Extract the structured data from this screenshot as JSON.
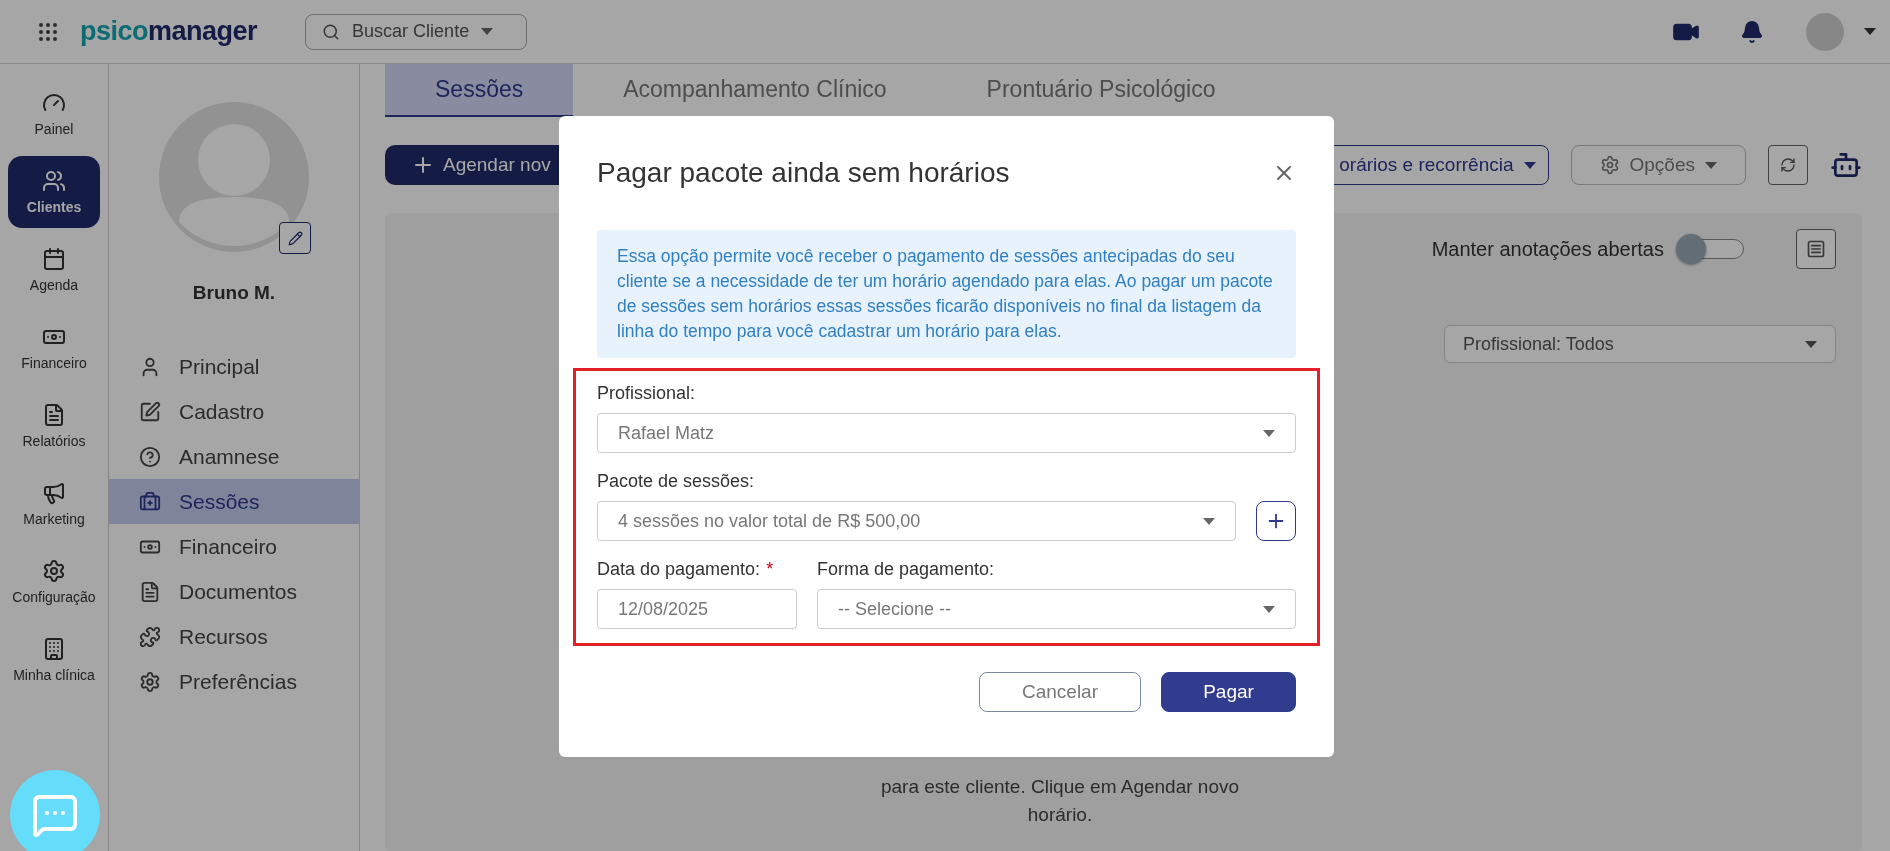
{
  "topbar": {
    "logo": [
      "psico",
      "manager"
    ],
    "search": {
      "label": "Buscar Cliente"
    }
  },
  "nav_rail": [
    {
      "label": "Painel",
      "selected": false
    },
    {
      "label": "Clientes",
      "selected": true
    },
    {
      "label": "Agenda",
      "selected": false
    },
    {
      "label": "Financeiro",
      "selected": false
    },
    {
      "label": "Relatórios",
      "selected": false
    },
    {
      "label": "Marketing",
      "selected": false
    },
    {
      "label": "Configuração",
      "selected": false
    },
    {
      "label": "Minha clínica",
      "selected": false
    }
  ],
  "client": {
    "name": "Bruno M."
  },
  "client_menu": [
    {
      "label": "Principal",
      "selected": false
    },
    {
      "label": "Cadastro",
      "selected": false
    },
    {
      "label": "Anamnese",
      "selected": false
    },
    {
      "label": "Sessões",
      "selected": true
    },
    {
      "label": "Financeiro",
      "selected": false
    },
    {
      "label": "Documentos",
      "selected": false
    },
    {
      "label": "Recursos",
      "selected": false
    },
    {
      "label": "Preferências",
      "selected": false
    }
  ],
  "tabs": [
    {
      "label": "Sessões",
      "selected": true
    },
    {
      "label": "Acompanhamento Clínico",
      "selected": false
    },
    {
      "label": "Prontuário Psicológico",
      "selected": false
    }
  ],
  "toolbar": {
    "new_button": "Agendar nov",
    "schedule_button": "orários e recorrência",
    "options_button": "Opções"
  },
  "notes_toggle": {
    "label": "Manter anotações abertas",
    "on": false
  },
  "professional_filter": {
    "value": "Profissional: Todos"
  },
  "empty_message": "para este cliente. Clique em Agendar novo horário.",
  "dialog": {
    "title": "Pagar pacote ainda sem horários",
    "info": "Essa opção permite você receber o pagamento de sessões antecipadas do seu cliente se a necessidade de ter um horário agendado para elas. Ao pagar um pacote de sessões sem horários essas sessões ficarão disponíveis no final da listagem da linha do tempo para você cadastrar um horário para elas.",
    "professional": {
      "label": "Profissional:",
      "value": "Rafael Matz"
    },
    "package": {
      "label": "Pacote de sessões:",
      "value": "4 sessões no valor total de R$ 500,00"
    },
    "payment_date": {
      "label": "Data do pagamento:",
      "required_mark": "*",
      "value": "12/08/2025"
    },
    "payment_method": {
      "label": "Forma de pagamento:",
      "value": "-- Selecione --"
    },
    "buttons": [
      {
        "label": "Cancelar",
        "kind": "secondary"
      },
      {
        "label": "Pagar",
        "kind": "primary"
      }
    ]
  }
}
